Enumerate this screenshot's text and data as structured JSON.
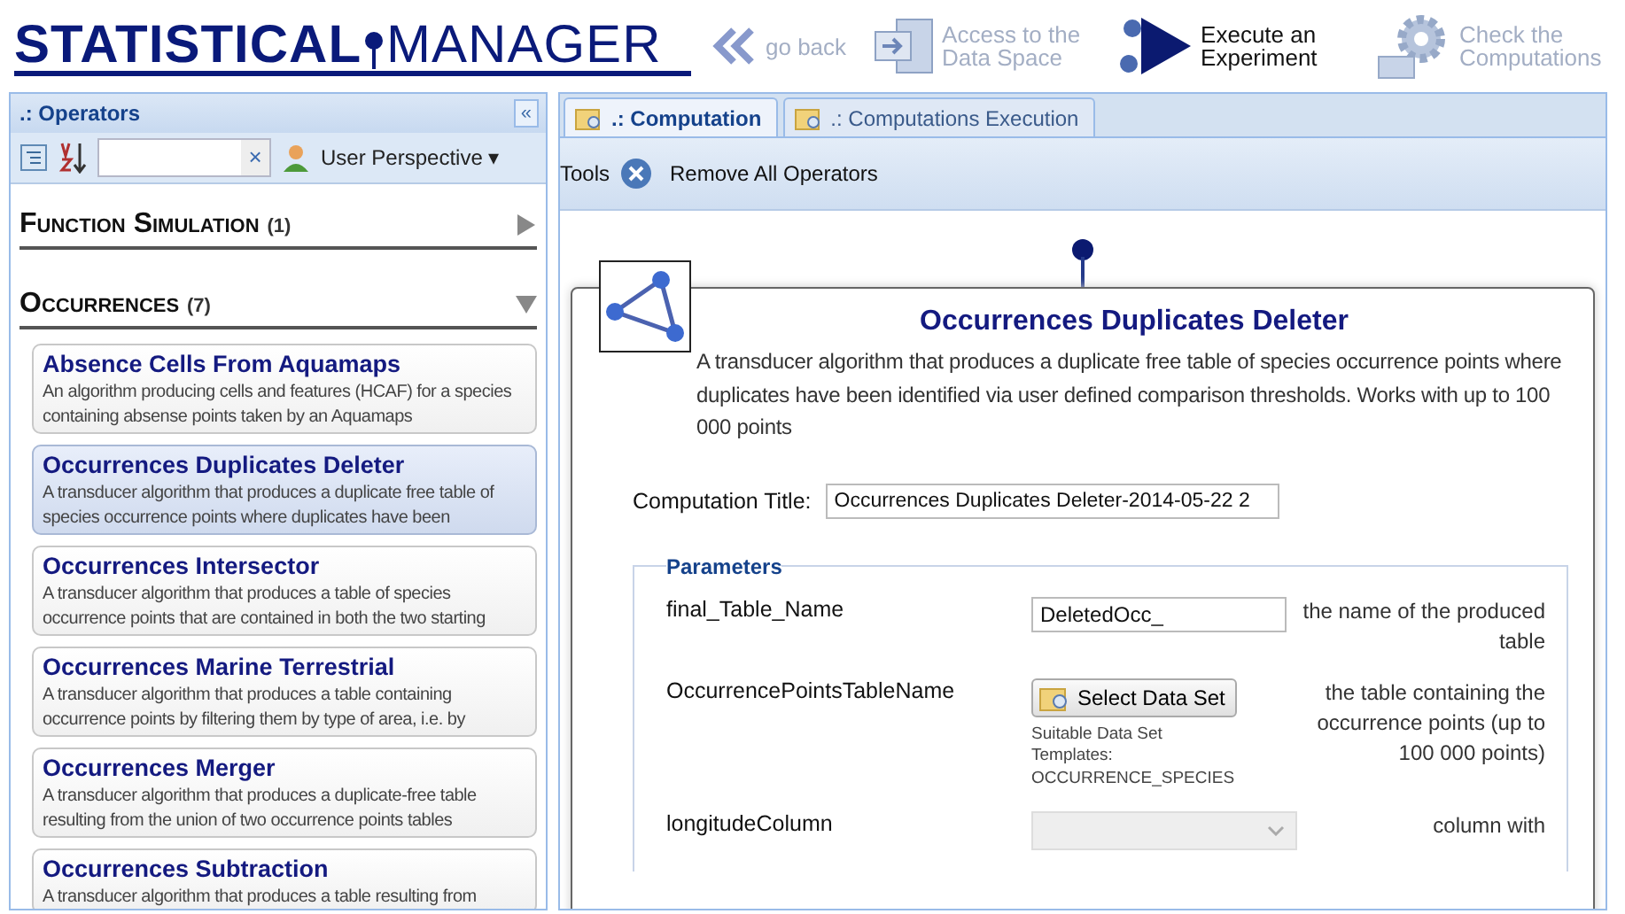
{
  "header": {
    "logo_left": "STATISTICAL",
    "logo_right": "MANAGER",
    "nav": [
      {
        "kind": "back",
        "label": "go back",
        "selected": false
      },
      {
        "kind": "data",
        "label": "Access to the Data Space",
        "selected": false
      },
      {
        "kind": "experiment",
        "label": "Execute an Experiment",
        "selected": true
      },
      {
        "kind": "computations",
        "label": "Check the Computations",
        "selected": false
      }
    ]
  },
  "operators": {
    "title": ".: Operators",
    "collapse": "«",
    "perspective": "User Perspective",
    "perspective_caret": "▾",
    "clear": "×",
    "categories": [
      {
        "name": "Function Simulation",
        "count": "(1)",
        "expanded": false
      },
      {
        "name": "Occurrences",
        "count": "(7)",
        "expanded": true,
        "items": [
          {
            "title": "Absence Cells From Aquamaps",
            "description": "An algorithm producing cells and features (HCAF) for a species containing absense points taken by an Aquamaps",
            "selected": false
          },
          {
            "title": "Occurrences Duplicates Deleter",
            "description": "A transducer algorithm that produces a duplicate free table of species occurrence points where duplicates have been",
            "selected": true
          },
          {
            "title": "Occurrences Intersector",
            "description": "A transducer algorithm that produces a table of species occurrence points that are contained in both the two starting",
            "selected": false
          },
          {
            "title": "Occurrences Marine Terrestrial",
            "description": "A transducer algorithm that produces a table containing occurrence points by filtering them by type of area, i.e. by",
            "selected": false
          },
          {
            "title": "Occurrences Merger",
            "description": "A transducer algorithm that produces a duplicate-free table resulting from the union of two occurrence points tables",
            "selected": false
          },
          {
            "title": "Occurrences Subtraction",
            "description": "A transducer algorithm that produces a table resulting from",
            "selected": false
          }
        ]
      }
    ]
  },
  "tabs": [
    {
      "label": ".: Computation",
      "selected": true
    },
    {
      "label": ".: Computations Execution",
      "selected": false
    }
  ],
  "toolbar": {
    "label": "Tools",
    "button": "Remove All Operators"
  },
  "algorithm": {
    "title": "Occurrences Duplicates Deleter",
    "description": "A transducer algorithm that produces a duplicate free table of species occurrence points where duplicates have been identified via user defined comparison thresholds. Works with up to 100 000 points"
  },
  "computation_title": {
    "label": "Computation Title:",
    "value": "Occurrences Duplicates Deleter-2014-05-22 2"
  },
  "parameters": {
    "legend": "Parameters",
    "rows": [
      {
        "kind": "text",
        "name": "final_Table_Name",
        "value": "DeletedOcc_",
        "description": "the name of the produced table"
      },
      {
        "kind": "dataset",
        "name": "OccurrencePointsTableName",
        "button": "Select Data Set",
        "hint": "Suitable Data Set Templates: OCCURRENCE_SPECIES",
        "description": "the table containing the occurrence points (up to 100 000 points)"
      },
      {
        "kind": "select",
        "name": "longitudeColumn",
        "description": "column with"
      }
    ]
  }
}
